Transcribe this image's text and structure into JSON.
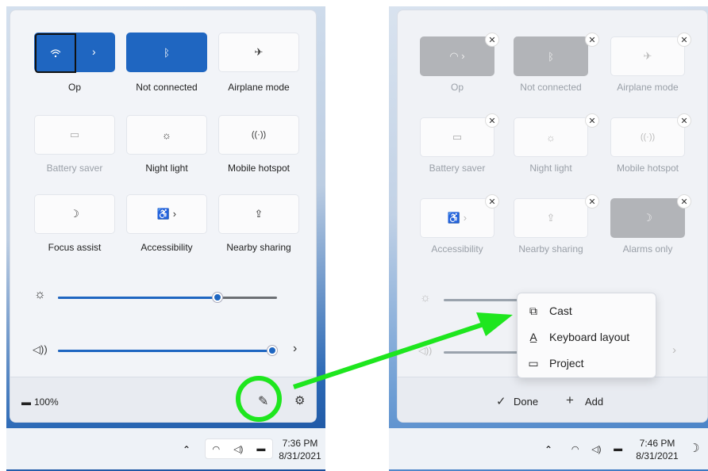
{
  "left": {
    "tiles": [
      {
        "label": "Op",
        "icon": "wifi-icon"
      },
      {
        "label": "Not connected",
        "icon": "bluetooth-icon"
      },
      {
        "label": "Airplane mode",
        "icon": "airplane-icon"
      },
      {
        "label": "Battery saver",
        "icon": "battery-saver-icon"
      },
      {
        "label": "Night light",
        "icon": "night-light-icon"
      },
      {
        "label": "Mobile hotspot",
        "icon": "mobile-hotspot-icon"
      },
      {
        "label": "Focus assist",
        "icon": "moon-icon"
      },
      {
        "label": "Accessibility",
        "icon": "accessibility-icon"
      },
      {
        "label": "Nearby sharing",
        "icon": "share-icon"
      }
    ],
    "brightness": 0.73,
    "volume": 0.98,
    "battery": "100%",
    "clock_time": "7:36 PM",
    "clock_date": "8/31/2021"
  },
  "right": {
    "tiles": [
      {
        "label": "Op"
      },
      {
        "label": "Not connected"
      },
      {
        "label": "Airplane mode"
      },
      {
        "label": "Battery saver"
      },
      {
        "label": "Night light"
      },
      {
        "label": "Mobile hotspot"
      },
      {
        "label": "Accessibility"
      },
      {
        "label": "Nearby sharing"
      },
      {
        "label": "Alarms only"
      }
    ],
    "menu": [
      "Cast",
      "Keyboard layout",
      "Project"
    ],
    "done": "Done",
    "add": "Add",
    "clock_time": "7:46 PM",
    "clock_date": "8/31/2021"
  },
  "colors": {
    "accent": "#1f66c1",
    "highlight": "#1ee61e"
  }
}
